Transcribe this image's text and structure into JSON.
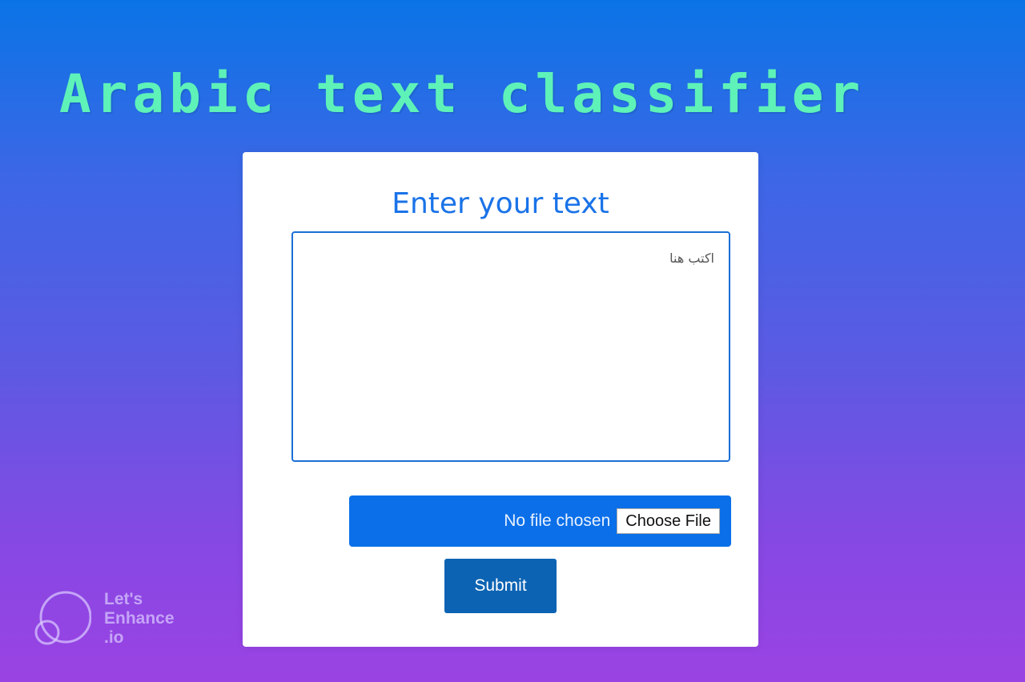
{
  "page": {
    "title": "Arabic text classifier"
  },
  "form": {
    "heading": "Enter your text",
    "textarea_placeholder": "اكتب هنا",
    "file_status": "No file chosen",
    "file_button_label": "Choose File",
    "submit_label": "Submit"
  },
  "watermark": {
    "line1": "Let's",
    "line2": "Enhance",
    "line3": ".io"
  }
}
